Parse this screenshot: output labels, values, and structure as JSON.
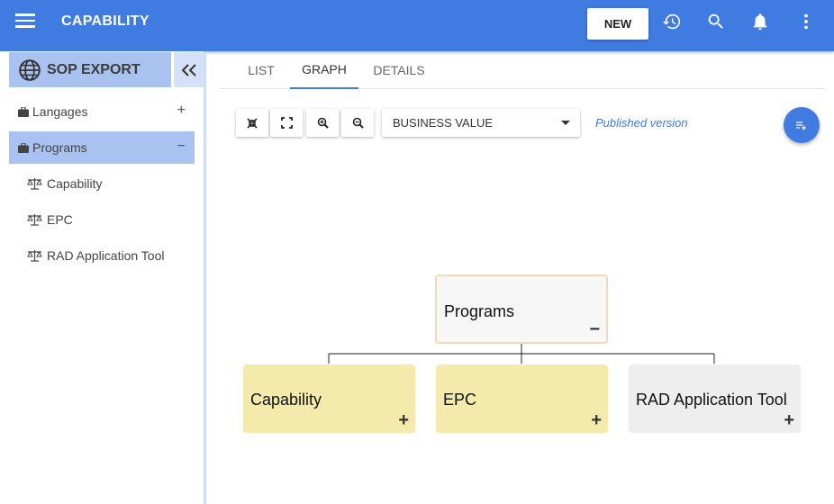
{
  "app": {
    "title": "CAPABILITY",
    "new_label": "NEW"
  },
  "colors": {
    "primary": "#3f7be0",
    "selected_bg": "#a9c2f0",
    "node_yellow": "#f3eaab",
    "node_gray": "#eeeeee",
    "node_root_border": "#f5d9b0"
  },
  "topbar_icons": [
    "history-icon",
    "search-icon",
    "bell-icon",
    "more-vert-icon"
  ],
  "sidebar": {
    "project": "SOP EXPORT",
    "items": [
      {
        "label": "Langages",
        "action": "+"
      },
      {
        "label": "Programs",
        "action": "−",
        "selected": true
      }
    ],
    "children": [
      {
        "label": "Capability"
      },
      {
        "label": "EPC"
      },
      {
        "label": "RAD Application Tool"
      }
    ]
  },
  "tabs": [
    {
      "label": "LIST"
    },
    {
      "label": "GRAPH",
      "active": true
    },
    {
      "label": "DETAILS"
    }
  ],
  "toolbar": {
    "select_value": "BUSINESS VALUE",
    "published": "Published version"
  },
  "graph": {
    "root": {
      "label": "Programs",
      "toggle": "−"
    },
    "children": [
      {
        "label": "Capability",
        "toggle": "+"
      },
      {
        "label": "EPC",
        "toggle": "+"
      },
      {
        "label": "RAD Application Tool",
        "toggle": "+"
      }
    ]
  }
}
